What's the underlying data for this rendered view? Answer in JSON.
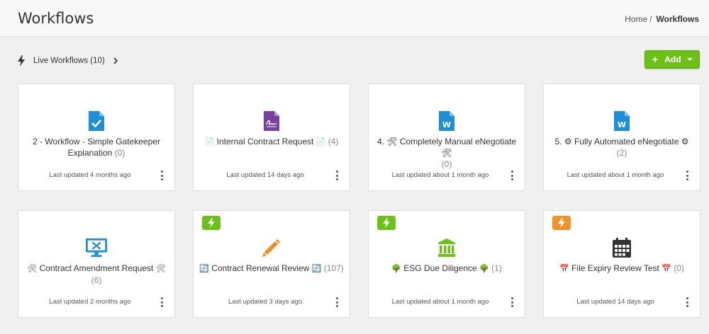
{
  "header": {
    "title": "Workflows"
  },
  "breadcrumb": {
    "home": "Home",
    "separator": "/",
    "current": "Workflows"
  },
  "toolbar": {
    "live_label": "Live Workflows (10)",
    "add_label": "Add"
  },
  "colors": {
    "accent_green": "#6cc117",
    "badge_orange": "#f0932b",
    "icon_blue": "#1e8ed6",
    "icon_purple": "#7b3f9e",
    "icon_orange": "#f08c1c",
    "icon_dark": "#333333"
  },
  "cards": [
    {
      "icon": "file-check-icon",
      "title": "2 - Workflow - Simple Gatekeeper Explanation",
      "prefix": "",
      "suffix": "",
      "count": "(0)",
      "updated": "Last updated 4 months ago",
      "badge": null
    },
    {
      "icon": "file-signature-icon",
      "title": "Internal Contract Request",
      "prefix": "📄",
      "suffix": "📄",
      "count": "(4)",
      "updated": "Last updated 14 days ago",
      "badge": null
    },
    {
      "icon": "word-file-icon",
      "title": "4. 🛠 Completely Manual eNegotiate 🛠",
      "prefix": "",
      "suffix": "",
      "count": "(0)",
      "updated": "Last updated about 1 month ago",
      "badge": null
    },
    {
      "icon": "word-file-icon",
      "title": "5. ⚙ Fully Automated eNegotiate ⚙",
      "prefix": "",
      "suffix": "",
      "count": "(2)",
      "updated": "Last updated about 1 month ago",
      "badge": null
    },
    {
      "icon": "desktop-tools-icon",
      "title": "Contract Amendment Request",
      "prefix": "🛠",
      "suffix": "🛠",
      "count": "(6)",
      "updated": "Last updated 2 months ago",
      "badge": null
    },
    {
      "icon": "pencil-icon",
      "title": "Contract Renewal Review",
      "prefix": "🔄",
      "suffix": "🔄",
      "count": "(107)",
      "updated": "Last updated 3 days ago",
      "badge": "green"
    },
    {
      "icon": "bank-icon",
      "title": "ESG Due Diligence",
      "prefix": "🌳",
      "suffix": "🌳",
      "count": "(1)",
      "updated": "Last updated about 1 month ago",
      "badge": "green"
    },
    {
      "icon": "calendar-icon",
      "title": "File Expiry Review Test",
      "prefix": "📅",
      "suffix": "📅",
      "count": "(0)",
      "updated": "Last updated 14 days ago",
      "badge": "orange"
    }
  ]
}
